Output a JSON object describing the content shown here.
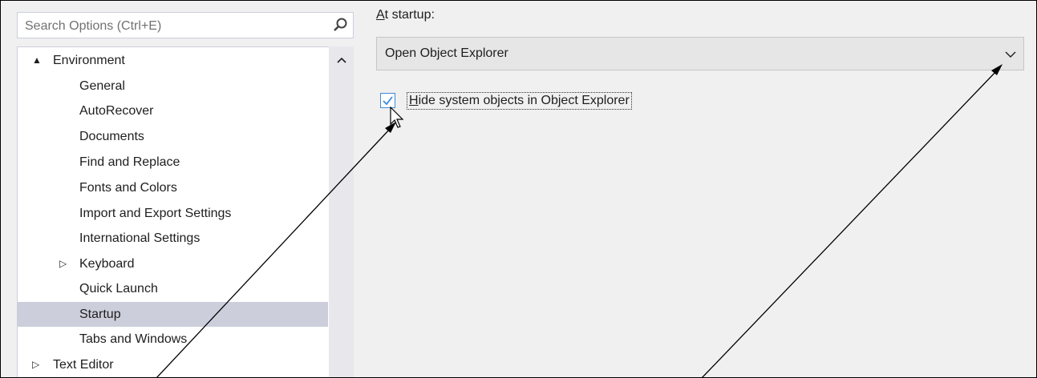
{
  "search": {
    "placeholder": "Search Options (Ctrl+E)"
  },
  "tree": {
    "items": [
      {
        "label": "Environment",
        "expander": "▲"
      },
      {
        "label": "General"
      },
      {
        "label": "AutoRecover"
      },
      {
        "label": "Documents"
      },
      {
        "label": "Find and Replace"
      },
      {
        "label": "Fonts and Colors"
      },
      {
        "label": "Import and Export Settings"
      },
      {
        "label": "International Settings"
      },
      {
        "label": "Keyboard",
        "expander": "▷"
      },
      {
        "label": "Quick Launch"
      },
      {
        "label": "Startup",
        "selected": true
      },
      {
        "label": "Tabs and Windows"
      },
      {
        "label": "Text Editor",
        "expander": "▷"
      }
    ]
  },
  "startup": {
    "label_mnemonic": "A",
    "label_rest": "t startup:",
    "selected_option": "Open Object Explorer"
  },
  "hide_system": {
    "checked": true,
    "label_mnemonic": "H",
    "label_rest": "ide system objects in Object Explorer"
  },
  "colors": {
    "accent": "#3c8bd9",
    "selection": "#cccedb"
  }
}
